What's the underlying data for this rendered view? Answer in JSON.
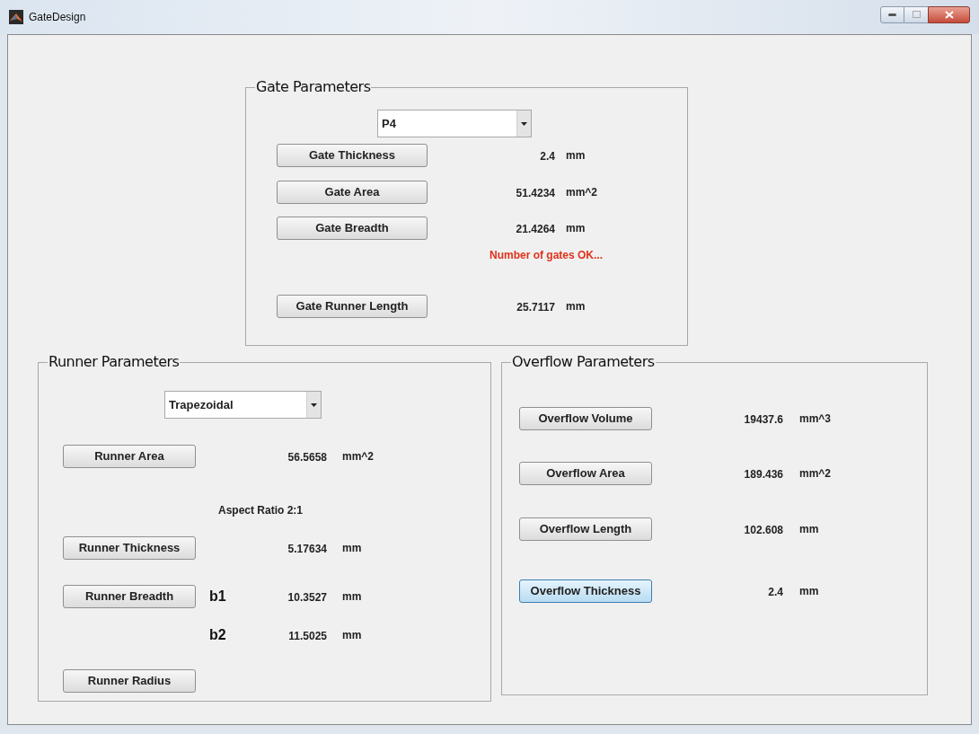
{
  "window": {
    "title": "GateDesign"
  },
  "gate_panel": {
    "title": "Gate Parameters",
    "dropdown": {
      "value": "P4"
    },
    "rows": [
      {
        "kind": "button",
        "label": "Gate Thickness",
        "value": "2.4",
        "unit": "mm",
        "focused": false
      },
      {
        "kind": "button",
        "label": "Gate Area",
        "value": "51.4234",
        "unit": "mm^2",
        "focused": false
      },
      {
        "kind": "button",
        "label": "Gate Breadth",
        "value": "21.4264",
        "unit": "mm",
        "focused": false
      },
      {
        "kind": "message",
        "text": "Number of gates OK..."
      },
      {
        "kind": "button",
        "label": "Gate Runner Length",
        "value": "25.7117",
        "unit": "mm",
        "focused": false
      }
    ]
  },
  "runner_panel": {
    "title": "Runner Parameters",
    "dropdown": {
      "value": "Trapezoidal"
    },
    "rows": [
      {
        "kind": "button",
        "label": "Runner Area",
        "value": "56.5658",
        "unit": "mm^2",
        "focused": false
      },
      {
        "kind": "note",
        "text": "Aspect Ratio 2:1"
      },
      {
        "kind": "button",
        "label": "Runner Thickness",
        "value": "5.17634",
        "unit": "mm",
        "focused": false
      },
      {
        "kind": "button",
        "label": "Runner Breadth",
        "tag": "b1",
        "value": "10.3527",
        "unit": "mm",
        "focused": false
      },
      {
        "kind": "tag",
        "tag": "b2",
        "value": "11.5025",
        "unit": "mm"
      },
      {
        "kind": "button",
        "label": "Runner Radius",
        "focused": false
      }
    ]
  },
  "overflow_panel": {
    "title": "Overflow Parameters",
    "rows": [
      {
        "kind": "button",
        "label": "Overflow Volume",
        "value": "19437.6",
        "unit": "mm^3",
        "focused": false
      },
      {
        "kind": "button",
        "label": "Overflow Area",
        "value": "189.436",
        "unit": "mm^2",
        "focused": false
      },
      {
        "kind": "button",
        "label": "Overflow Length",
        "value": "102.608",
        "unit": "mm",
        "focused": false
      },
      {
        "kind": "button",
        "label": "Overflow Thickness",
        "value": "2.4",
        "unit": "mm",
        "focused": true
      }
    ]
  }
}
